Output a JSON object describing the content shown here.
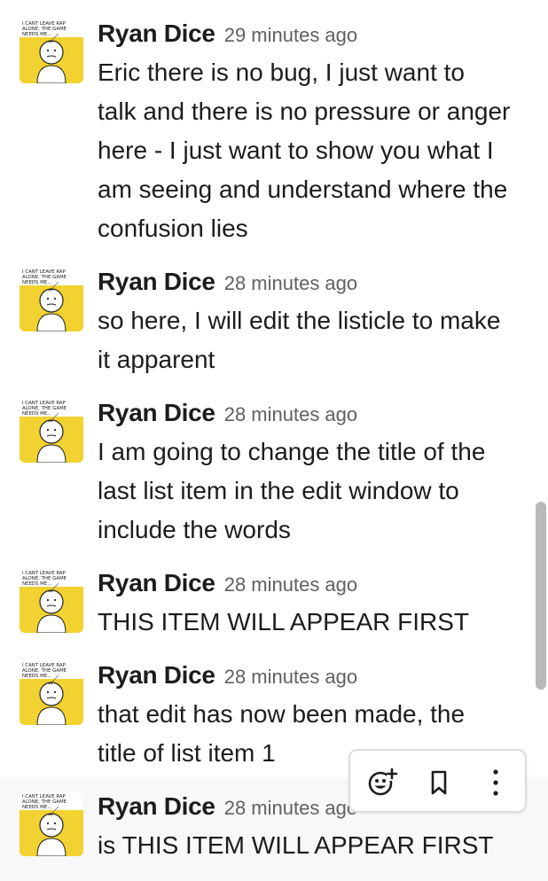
{
  "avatar": {
    "caption_line1": "I CANT LEAVE RAP",
    "caption_line2": "ALONE, THE GAME",
    "caption_line3": "NEEDS ME...",
    "background_color": "#f2d230"
  },
  "messages": [
    {
      "author": "Ryan Dice",
      "timestamp": "29 minutes ago",
      "text": "Eric there is no bug, I just want to\ntalk and there is no pressure or anger\nhere - I just want to show you what I\nam seeing and understand where the\nconfusion lies"
    },
    {
      "author": "Ryan Dice",
      "timestamp": "28 minutes ago",
      "text": "so here, I will edit the listicle to make\nit apparent"
    },
    {
      "author": "Ryan Dice",
      "timestamp": "28 minutes ago",
      "text": "I am going to change the title of the\nlast list item in the edit window to\ninclude the words"
    },
    {
      "author": "Ryan Dice",
      "timestamp": "28 minutes ago",
      "text": "THIS ITEM WILL APPEAR FIRST"
    },
    {
      "author": "Ryan Dice",
      "timestamp": "28 minutes ago",
      "text": "that edit has now been made, the\ntitle of list item 1"
    },
    {
      "author": "Ryan Dice",
      "timestamp": "28 minutes ago",
      "text": "is THIS ITEM WILL APPEAR FIRST"
    }
  ],
  "hover_toolbar": {
    "icons": [
      "add-reaction-icon",
      "bookmark-icon",
      "more-actions-icon"
    ]
  },
  "colors": {
    "timestamp": "#616061",
    "hover_background": "#f8f8f8",
    "scrollbar": "#b9b9b9"
  }
}
